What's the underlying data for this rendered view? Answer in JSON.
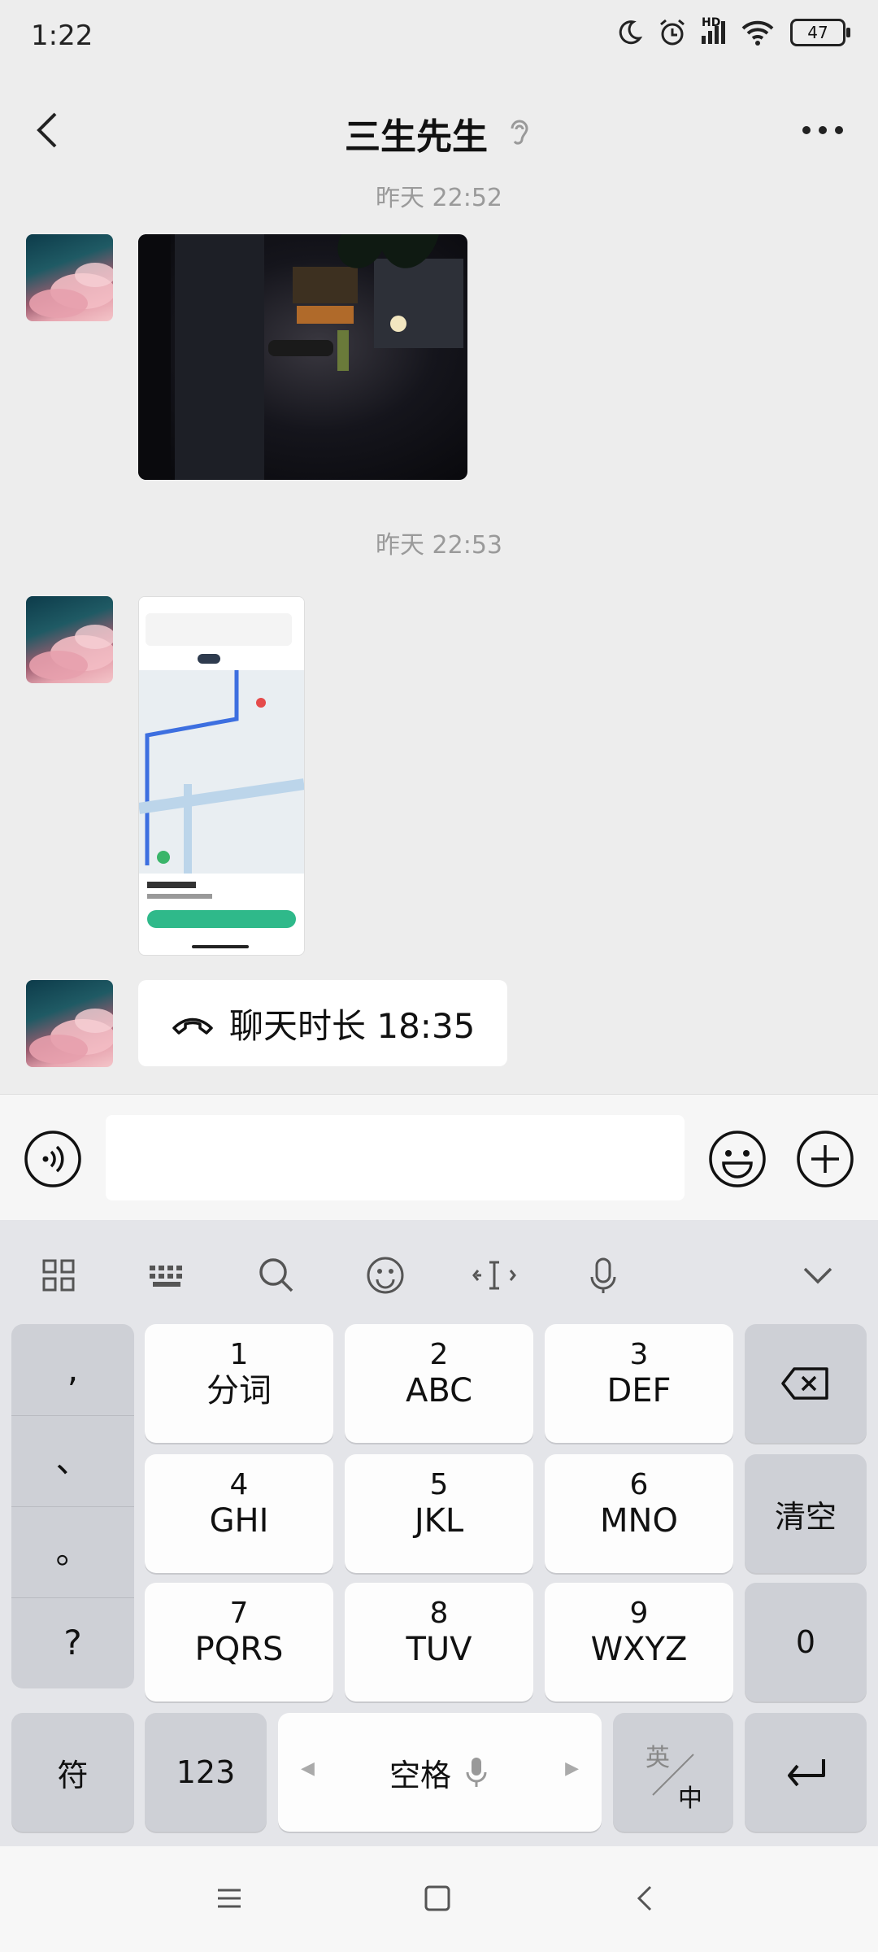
{
  "status_bar": {
    "time": "1:22",
    "battery": "47",
    "signal_label": "HD"
  },
  "header": {
    "title": "三生先生"
  },
  "chat": {
    "timestamp_partial": "昨天 22:52",
    "timestamp_2": "昨天 22:53",
    "call_message": "聊天时长 18:35"
  },
  "input": {
    "placeholder": ""
  },
  "keyboard": {
    "punctuation": [
      ",",
      "、",
      "。",
      "?"
    ],
    "keys": [
      {
        "num": "1",
        "letters": "分词"
      },
      {
        "num": "2",
        "letters": "ABC"
      },
      {
        "num": "3",
        "letters": "DEF"
      },
      {
        "num": "4",
        "letters": "GHI"
      },
      {
        "num": "5",
        "letters": "JKL"
      },
      {
        "num": "6",
        "letters": "MNO"
      },
      {
        "num": "7",
        "letters": "PQRS"
      },
      {
        "num": "8",
        "letters": "TUV"
      },
      {
        "num": "9",
        "letters": "WXYZ"
      }
    ],
    "clear_label": "清空",
    "zero_label": "0",
    "symbol_label": "符",
    "num_label": "123",
    "space_label": "空格",
    "lang_en": "英",
    "lang_zh": "中"
  },
  "colors": {
    "background": "#ededed",
    "bubble": "#ffffff",
    "keyboard_bg": "#e4e5e9"
  }
}
